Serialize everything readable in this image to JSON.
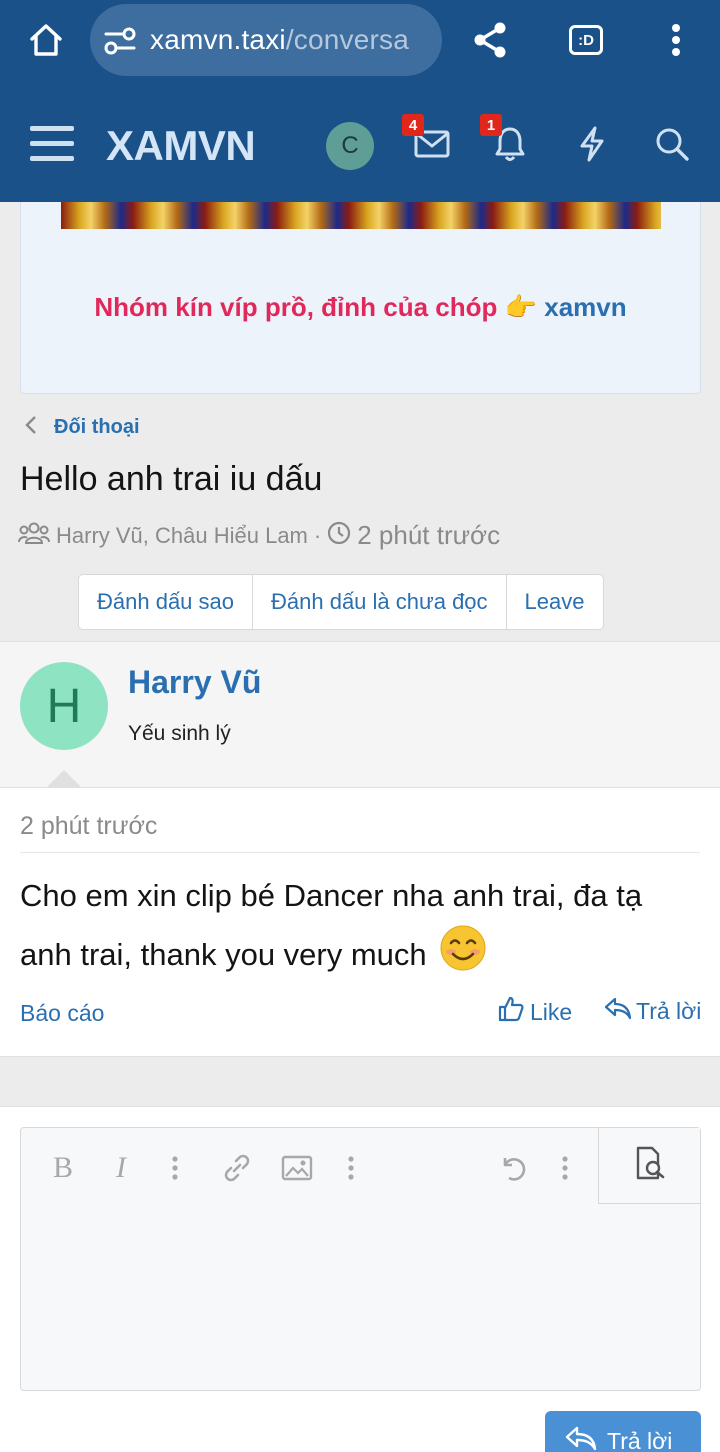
{
  "browser": {
    "url_host": "xamvn.taxi",
    "url_path": "/conversa",
    "tab_label": ":D"
  },
  "header": {
    "logo": "XAMVN",
    "avatar_initial": "C",
    "inbox_count": "4",
    "alerts_count": "1"
  },
  "banner": {
    "text": "Nhóm kín víp prồ, đỉnh của chóp",
    "emoji": "👉",
    "link": "xamvn"
  },
  "breadcrumb": {
    "label": "Đối thoại"
  },
  "conversation": {
    "title": "Hello anh trai iu dấu",
    "participants": "Harry Vũ, Châu Hiểu Lam",
    "separator": "·",
    "time": "2 phút trước"
  },
  "actions": [
    "Đánh dấu sao",
    "Đánh dấu là chưa đọc",
    "Leave"
  ],
  "message": {
    "avatar_letter": "H",
    "username": "Harry Vũ",
    "user_title": "Yếu sinh lý",
    "time": "2 phút trước",
    "text": "Cho em xin clip bé Dancer nha anh trai, đa tạ anh trai, thank you very much",
    "report_label": "Báo cáo",
    "like_label": "Like",
    "reply_label": "Trả lời"
  },
  "editor": {
    "bold_label": "B",
    "italic_label": "I",
    "send_label": "Trả lời"
  },
  "colors": {
    "header_bg": "#1a5189",
    "link": "#2a6fb0",
    "banner_text": "#e0285a",
    "badge": "#e1261c",
    "send_button": "#4a90d4"
  }
}
